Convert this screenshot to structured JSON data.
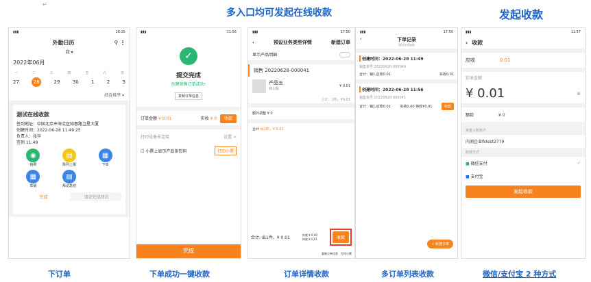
{
  "headings": {
    "entries": "多入口均可发起在线收款",
    "collect": "发起收款"
  },
  "captions": [
    "下订单",
    "下单成功一键收款",
    "订单详情收款",
    "多订单列表收款",
    "微信/支付宝 2 种方式"
  ],
  "p1": {
    "time": "16:35",
    "title": "外勤日历",
    "me": "我 ▾",
    "month": "2022年06月",
    "week": [
      "一",
      "二",
      "三",
      "四",
      "五",
      "六",
      "日"
    ],
    "days": [
      "27",
      "28",
      "29",
      "30",
      "1",
      "2",
      "3"
    ],
    "sort": "综合排序 ▾",
    "card_title": "测试在线收款",
    "addr": "签到地址：中国北京市海淀区知春路卫星大厦",
    "created": "创建时间：2022-06-28 11:49:25",
    "owner": "负责人：张华",
    "checkin": "签到 11:49",
    "actions": [
      "拍照",
      "陈列上报",
      "下单",
      "车销",
      "拜访总结"
    ],
    "done": "完成",
    "tip": "请说完成拜访"
  },
  "p2": {
    "time": "11:56",
    "title": "提交完成",
    "sub": "创建销售订单成功!",
    "copy": "复制订单信息",
    "amount_label": "订单金额",
    "amount": "¥ 0.01",
    "paid_label": "实收",
    "paid": "¥ 0",
    "collect": "收款",
    "printer": "打印设备未连接",
    "setting": "设置 >",
    "barcode": "小票上显示产品条形码",
    "print": "打印小票",
    "done": "完成"
  },
  "p3": {
    "time": "17:50",
    "title": "预设业务类型详情",
    "new": "新建订单",
    "show": "显示产品明细",
    "order": "销售 20220628-000041",
    "product": "产品五",
    "unit": "销1/瓶",
    "price": "¥ 0.01",
    "subtotal": "小计：1件，¥0.01",
    "adjust_label": "额外调整",
    "adjust": "¥ 0",
    "total_label": "合计",
    "total": "出1件，¥ 0.01",
    "paid": "实收 ¥ 0.00",
    "pending": "待收 ¥ 0.01",
    "collect": "收款",
    "bottom": "合计: 出1件，¥ 0.01",
    "copy": "复制订单信息",
    "print": "打印小票"
  },
  "p4": {
    "time": "17:50",
    "title": "下单记录",
    "sub": "测试在线收款",
    "orders": [
      {
        "time": "创建时间：2022-06-28 11:49",
        "no": "销售单号:20220628-000040",
        "sum": "合计：销1,应收0.01",
        "right": "实收0.01"
      },
      {
        "time": "创建时间：2022-06-28 11:56",
        "no": "销售单号:20220628-000041",
        "sum": "合计：销1,应收0.01",
        "right": "实收0.00 待收¥0.01"
      }
    ],
    "collect": "收款",
    "new": "+ 新建订单"
  },
  "p5": {
    "time": "11:57",
    "title": "收款",
    "due_label": "应收",
    "due": "0.01",
    "paid_label": "实收金额",
    "paid": "¥ 0.01",
    "sub_label": "额款",
    "sub": "¥ 0",
    "account_label": "资金入账账户",
    "account": "内测企业fktest2779",
    "method_label": "收款方式",
    "wechat": "微信支付",
    "alipay": "支付宝",
    "submit": "发起收款"
  }
}
